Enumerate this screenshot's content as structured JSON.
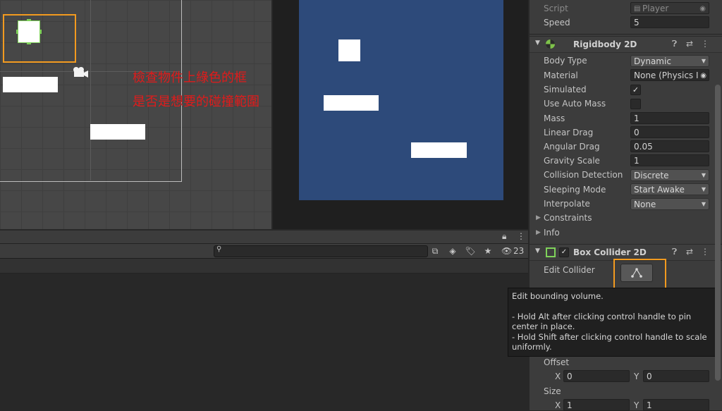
{
  "annotation": {
    "line1": "檢查物件上綠色的框",
    "line2": "是否是想要的碰撞範圍"
  },
  "project_toolbar": {
    "search_placeholder": "",
    "hidden_count": "23"
  },
  "inspector": {
    "script_label": "Script",
    "script_value": "Player",
    "speed_label": "Speed",
    "speed_value": "5",
    "rigidbody": {
      "title": "Rigidbody 2D",
      "body_type_label": "Body Type",
      "body_type_value": "Dynamic",
      "material_label": "Material",
      "material_value": "None (Physics I",
      "simulated_label": "Simulated",
      "simulated_checked": "✓",
      "use_auto_mass_label": "Use Auto Mass",
      "mass_label": "Mass",
      "mass_value": "1",
      "linear_drag_label": "Linear Drag",
      "linear_drag_value": "0",
      "angular_drag_label": "Angular Drag",
      "angular_drag_value": "0.05",
      "gravity_scale_label": "Gravity Scale",
      "gravity_scale_value": "1",
      "collision_detection_label": "Collision Detection",
      "collision_detection_value": "Discrete",
      "sleeping_mode_label": "Sleeping Mode",
      "sleeping_mode_value": "Start Awake",
      "interpolate_label": "Interpolate",
      "interpolate_value": "None",
      "constraints_label": "Constraints",
      "info_label": "Info"
    },
    "box_collider": {
      "title": "Box Collider 2D",
      "edit_collider_label": "Edit Collider",
      "offset_label": "Offset",
      "offset_x_label": "X",
      "offset_x_value": "0",
      "offset_y_label": "Y",
      "offset_y_value": "0",
      "size_label": "Size",
      "size_x_label": "X",
      "size_x_value": "1",
      "size_y_label": "Y",
      "size_y_value": "1"
    },
    "tooltip": {
      "line1": "Edit bounding volume.",
      "line2": " - Hold Alt after clicking control handle to pin center in place.",
      "line3": " - Hold Shift after clicking control handle to scale uniformly."
    }
  },
  "colors": {
    "highlight": "#f29a1f",
    "annotation_text": "#e01b1b",
    "game_background": "#2d4a7a",
    "collider_outline": "#7fd35a"
  }
}
